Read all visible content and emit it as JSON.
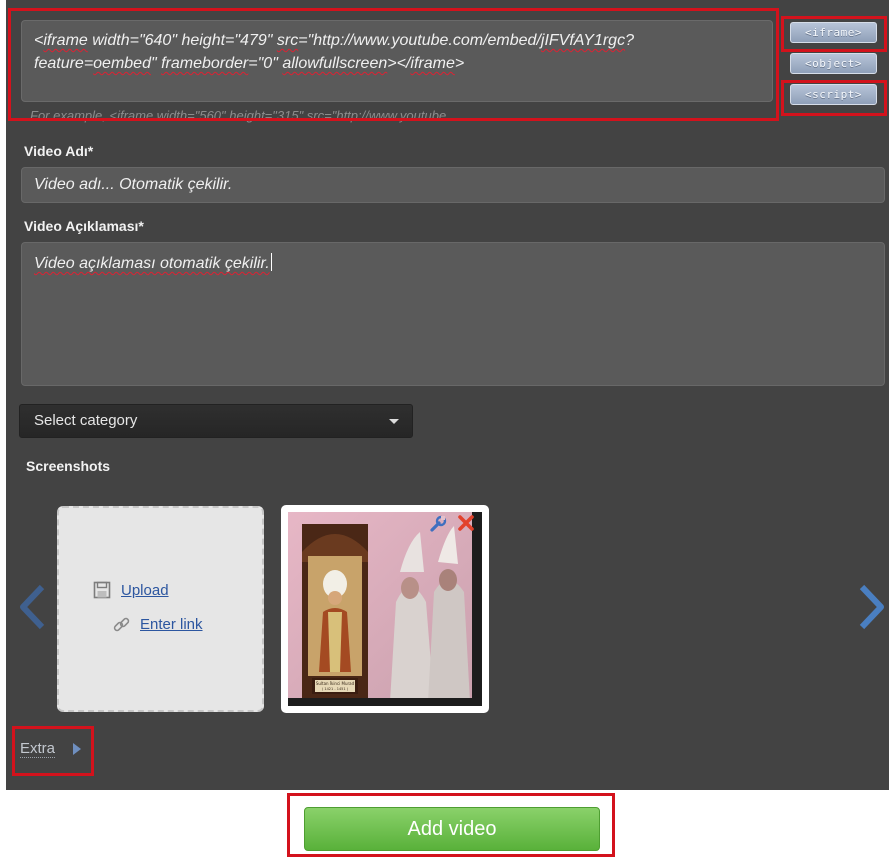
{
  "embed": {
    "code_parts": [
      {
        "text": "<",
        "sq": false
      },
      {
        "text": "iframe",
        "sq": true
      },
      {
        "text": " width=\"640\" height=\"479\" ",
        "sq": false
      },
      {
        "text": "src",
        "sq": true
      },
      {
        "text": "=\"http://www.youtube.com/embed/",
        "sq": false
      },
      {
        "text": "jIFVfAY1rgc",
        "sq": true
      },
      {
        "text": "?",
        "sq": false
      },
      {
        "br": true
      },
      {
        "text": "feature=",
        "sq": false
      },
      {
        "text": "oembed",
        "sq": true
      },
      {
        "text": "\" ",
        "sq": false
      },
      {
        "text": "frameborder",
        "sq": true
      },
      {
        "text": "=\"0\" ",
        "sq": false
      },
      {
        "text": "allowfullscreen",
        "sq": true
      },
      {
        "text": "></",
        "sq": false
      },
      {
        "text": "iframe",
        "sq": true
      },
      {
        "text": ">",
        "sq": false
      }
    ],
    "hint": "For example, <iframe width=\"560\" height=\"315\" src=\"http://www.youtube...",
    "buttons": [
      "<iframe>",
      "<object>",
      "<script>"
    ]
  },
  "video_name": {
    "label": "Video Adı*",
    "value": "Video adı... Otomatik çekilir."
  },
  "video_description": {
    "label": "Video Açıklaması*",
    "value": "Video açıklaması otomatik çekilir."
  },
  "category": {
    "selected": "Select category"
  },
  "screenshots": {
    "label": "Screenshots",
    "upload_label": "Upload",
    "enter_link_label": "Enter link",
    "thumb_caption_line1": "Sultan İkinci Murad",
    "thumb_caption_line2": "( 1421 - 1451 )"
  },
  "extra": {
    "label": "Extra"
  },
  "actions": {
    "add_video_label": "Add video"
  },
  "colors": {
    "panel_bg": "#434343",
    "field_bg": "#5a5a5a",
    "highlight_red": "#d3121c",
    "add_button_green": "#5cb23d",
    "nav_arrow_blue": "#4a7fc1",
    "tag_button_blue": "#9fb0c8"
  },
  "icons": {
    "upload": "floppy-disk-icon",
    "enter_link": "chain-link-icon",
    "edit_thumb": "wrench-icon",
    "delete_thumb": "close-icon",
    "carousel_prev": "chevron-left-icon",
    "carousel_next": "chevron-right-icon",
    "extra_toggle": "triangle-right-icon",
    "category_dropdown": "caret-down-icon"
  }
}
